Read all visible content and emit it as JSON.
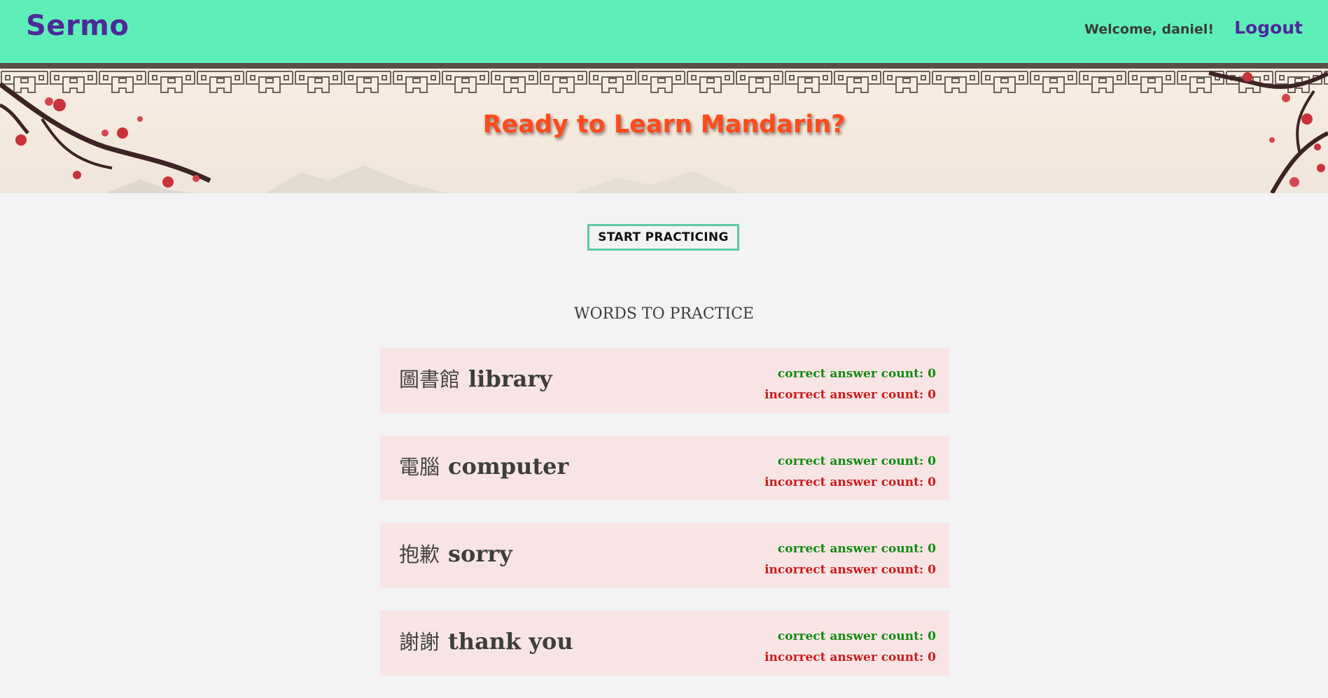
{
  "nav": {
    "brand": "Sermo",
    "welcome": "Welcome, daniel!",
    "logout": "Logout"
  },
  "banner": {
    "title": "Ready to Learn Mandarin?"
  },
  "practice_button": "START PRACTICING",
  "section_title": "WORDS TO PRACTICE",
  "words": [
    {
      "hanzi": "圖書館",
      "english": "library",
      "correct_label": "correct answer count:",
      "correct": "0",
      "incorrect_label": "incorrect answer count:",
      "incorrect": "0"
    },
    {
      "hanzi": "電腦",
      "english": "computer",
      "correct_label": "correct answer count:",
      "correct": "0",
      "incorrect_label": "incorrect answer count:",
      "incorrect": "0"
    },
    {
      "hanzi": "抱歉",
      "english": "sorry",
      "correct_label": "correct answer count:",
      "correct": "0",
      "incorrect_label": "incorrect answer count:",
      "incorrect": "0"
    },
    {
      "hanzi": "謝謝",
      "english": "thank you",
      "correct_label": "correct answer count:",
      "correct": "0",
      "incorrect_label": "incorrect answer count:",
      "incorrect": "0"
    }
  ],
  "colors": {
    "navbar": "#5eefb9",
    "brand": "#4d2a99",
    "banner_title": "#ff4a1c",
    "card_bg": "#f9e4e5",
    "correct": "#128a12",
    "incorrect": "#c91d1d",
    "button_border": "#5cc9a0"
  }
}
